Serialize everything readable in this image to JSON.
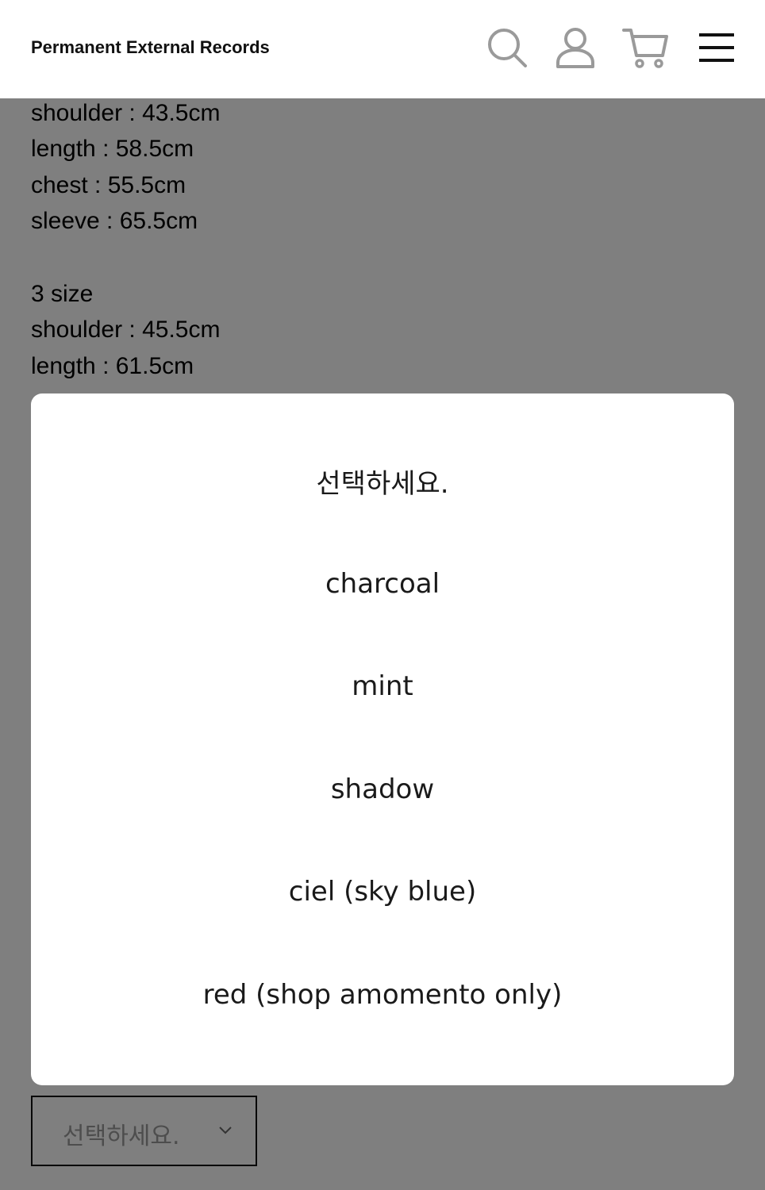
{
  "header": {
    "brand": "Permanent External Records",
    "icons": [
      "search-icon",
      "user-icon",
      "cart-icon",
      "menu-icon"
    ]
  },
  "content": {
    "spec_lines": [
      "shoulder : 43.5cm",
      "length : 58.5cm",
      "chest : 55.5cm",
      "sleeve : 65.5cm",
      "3 size",
      "shoulder : 45.5cm",
      "length : 61.5cm"
    ]
  },
  "picker": {
    "options": [
      "선택하세요.",
      "charcoal",
      "mint",
      "shadow",
      "ciel (sky blue)",
      "red (shop amomento only)"
    ]
  },
  "select": {
    "value": "선택하세요."
  }
}
